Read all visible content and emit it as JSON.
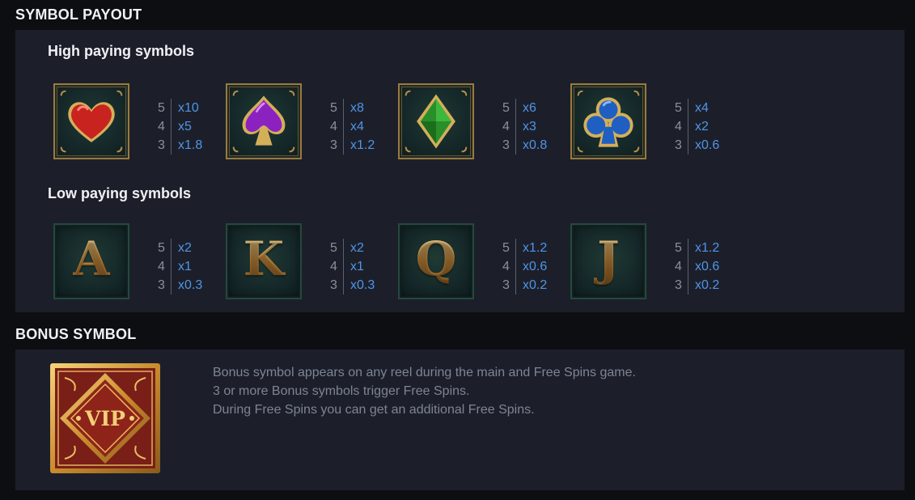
{
  "sections": {
    "payout_title": "SYMBOL PAYOUT",
    "bonus_title": "BONUS SYMBOL"
  },
  "high": {
    "label": "High paying symbols",
    "symbols": [
      {
        "icon": "heart-icon",
        "color": "#d32a2a",
        "counts": [
          "5",
          "4",
          "3"
        ],
        "payouts": [
          "x10",
          "x5",
          "x1.8"
        ]
      },
      {
        "icon": "spade-icon",
        "color": "#8a2bc2",
        "counts": [
          "5",
          "4",
          "3"
        ],
        "payouts": [
          "x8",
          "x4",
          "x1.2"
        ]
      },
      {
        "icon": "diamond-icon",
        "color": "#2f9a2f",
        "counts": [
          "5",
          "4",
          "3"
        ],
        "payouts": [
          "x6",
          "x3",
          "x0.8"
        ]
      },
      {
        "icon": "club-icon",
        "color": "#2a66c8",
        "counts": [
          "5",
          "4",
          "3"
        ],
        "payouts": [
          "x4",
          "x2",
          "x0.6"
        ]
      }
    ]
  },
  "low": {
    "label": "Low paying symbols",
    "symbols": [
      {
        "letter": "A",
        "counts": [
          "5",
          "4",
          "3"
        ],
        "payouts": [
          "x2",
          "x1",
          "x0.3"
        ]
      },
      {
        "letter": "K",
        "counts": [
          "5",
          "4",
          "3"
        ],
        "payouts": [
          "x2",
          "x1",
          "x0.3"
        ]
      },
      {
        "letter": "Q",
        "counts": [
          "5",
          "4",
          "3"
        ],
        "payouts": [
          "x1.2",
          "x0.6",
          "x0.2"
        ]
      },
      {
        "letter": "J",
        "counts": [
          "5",
          "4",
          "3"
        ],
        "payouts": [
          "x1.2",
          "x0.6",
          "x0.2"
        ]
      }
    ]
  },
  "bonus": {
    "symbol_text": "VIP",
    "description": [
      "Bonus symbol appears on any reel during the main and Free Spins game.",
      "3 or more Bonus symbols trigger Free Spins.",
      "During Free Spins you can get an additional Free Spins."
    ]
  }
}
